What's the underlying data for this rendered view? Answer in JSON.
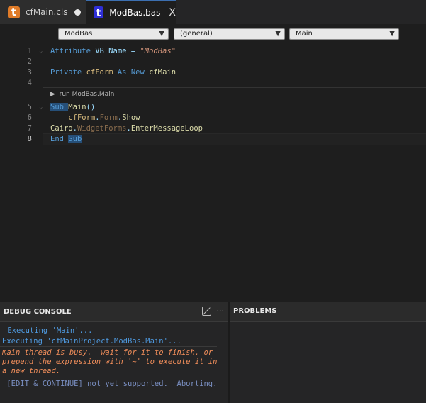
{
  "tabs": [
    {
      "label": "cfMain.cls",
      "icon": "t",
      "modified": true
    },
    {
      "label": "ModBas.bas",
      "icon": "t",
      "close": "X"
    }
  ],
  "dropdowns": {
    "module": "ModBas",
    "scope": "(general)",
    "member": "Main"
  },
  "editor": {
    "lines": [
      {
        "n": "1",
        "tokens": [
          [
            "kw",
            "Attribute "
          ],
          [
            "plain",
            "VB_Name"
          ],
          [
            "plain",
            " = "
          ],
          [
            "str",
            "\"ModBas\""
          ]
        ]
      },
      {
        "n": "2",
        "tokens": []
      },
      {
        "n": "3",
        "tokens": [
          [
            "kw",
            "Private "
          ],
          [
            "obj",
            "cfForm"
          ],
          [
            "kw",
            " As "
          ],
          [
            "kw",
            "New "
          ],
          [
            "cls",
            "cfMain"
          ]
        ]
      },
      {
        "n": "4",
        "tokens": []
      },
      {
        "n": "5",
        "tokens": [
          [
            "kw",
            "Sub "
          ],
          [
            "cls",
            "Main"
          ],
          [
            "plain",
            "()"
          ]
        ]
      },
      {
        "n": "6",
        "tokens": [
          [
            "plain",
            "    "
          ],
          [
            "obj",
            "cfForm"
          ],
          [
            "plain",
            "."
          ],
          [
            "dim",
            "Form"
          ],
          [
            "plain",
            "."
          ],
          [
            "cls",
            "Show"
          ]
        ]
      },
      {
        "n": "7",
        "tokens": [
          [
            "cls",
            "Cairo"
          ],
          [
            "plain",
            "."
          ],
          [
            "dim",
            "WidgetForms"
          ],
          [
            "plain",
            "."
          ],
          [
            "cls",
            "EnterMessageLoop"
          ]
        ]
      },
      {
        "n": "8",
        "tokens": [
          [
            "kw",
            "End "
          ],
          [
            "kw",
            "Sub"
          ]
        ]
      }
    ],
    "codelens": "run ModBas.Main"
  },
  "debug_console": {
    "title": "DEBUG CONSOLE",
    "more": "···",
    "lines": [
      {
        "style": "cblue",
        "text": " Executing 'Main'..."
      },
      {
        "style": "cblue",
        "text": "Executing 'cfMainProject.ModBas.Main'..."
      },
      {
        "style": "corange",
        "text": "main thread is busy.  wait for it to finish, or"
      },
      {
        "style": "corange",
        "text": "prepend the expression with '~' to execute it in"
      },
      {
        "style": "corange",
        "text": "a new thread."
      },
      {
        "style": "cgrey",
        "text": " [EDIT & CONTINUE] not yet supported.  Aborting."
      }
    ]
  },
  "problems": {
    "title": "PROBLEMS"
  }
}
